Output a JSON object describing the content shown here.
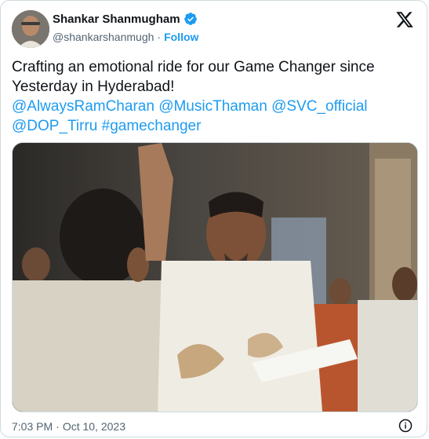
{
  "author": {
    "name": "Shankar Shanmugham",
    "handle": "@shankarshanmugh",
    "separator": "·",
    "follow_label": "Follow"
  },
  "tweet": {
    "line1": "Crafting an emotional ride for our Game Changer since",
    "line2": "Yesterday in Hyderabad!",
    "mentions": [
      "@AlwaysRamCharan",
      "@MusicThaman",
      "@SVC_official",
      "@DOP_Tirru",
      "#gamechanger"
    ]
  },
  "footer": {
    "time": "7:03 PM",
    "separator": "·",
    "date": "Oct 10, 2023"
  },
  "icons": {
    "verified": "verified-badge-icon",
    "platform": "x-logo-icon",
    "info": "info-icon"
  },
  "colors": {
    "accent": "#1d9bf0",
    "text": "#0f1419",
    "muted": "#536471",
    "border": "#cfd9de"
  }
}
